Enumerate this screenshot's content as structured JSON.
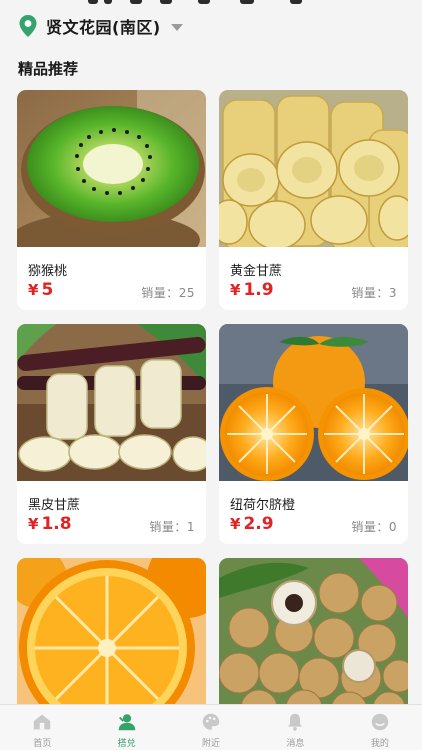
{
  "location": {
    "name": "贤文花园(南区)",
    "icon": "location-pin-icon",
    "accent": "#36a36c"
  },
  "section": {
    "title": "精品推荐"
  },
  "products": [
    {
      "name": "猕猴桃",
      "currency": "¥",
      "price": "5",
      "sales_label": "销量：",
      "sales": "25",
      "image": "kiwi-photo"
    },
    {
      "name": "黄金甘蔗",
      "currency": "¥",
      "price": "1.9",
      "sales_label": "销量：",
      "sales": "3",
      "image": "golden-sugarcane-photo"
    },
    {
      "name": "黑皮甘蔗",
      "currency": "¥",
      "price": "1.8",
      "sales_label": "销量：",
      "sales": "1",
      "image": "black-sugarcane-photo"
    },
    {
      "name": "纽荷尔脐橙",
      "currency": "¥",
      "price": "2.9",
      "sales_label": "销量：",
      "sales": "0",
      "image": "navel-orange-photo"
    },
    {
      "image": "orange-half-photo"
    },
    {
      "image": "longan-photo"
    }
  ],
  "tabbar": {
    "active_color": "#36a36c",
    "items": [
      {
        "label": "首页",
        "icon": "home-icon"
      },
      {
        "label": "搭兑",
        "icon": "group-icon",
        "active": true
      },
      {
        "label": "附近",
        "icon": "palette-icon"
      },
      {
        "label": "消息",
        "icon": "bell-icon"
      },
      {
        "label": "我的",
        "icon": "profile-icon"
      }
    ]
  }
}
